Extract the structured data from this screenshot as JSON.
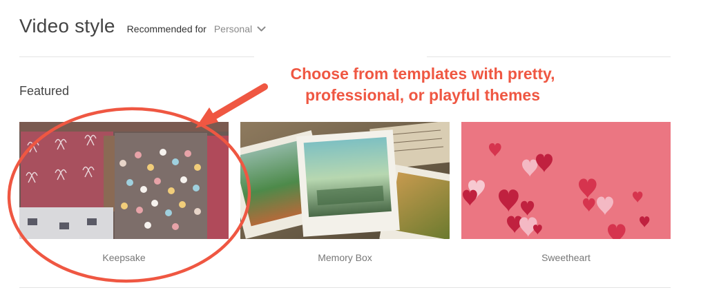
{
  "header": {
    "title": "Video style",
    "recommended_label": "Recommended for",
    "recommended_value": "Personal"
  },
  "section": {
    "title": "Featured"
  },
  "cards": [
    {
      "label": "Keepsake"
    },
    {
      "label": "Memory Box"
    },
    {
      "label": "Sweetheart"
    }
  ],
  "annotation": {
    "line1": "Choose from templates with pretty,",
    "line2": "professional, or playful themes",
    "color": "#ef5742"
  },
  "icons": {
    "dropdown": "chevron-down-icon"
  }
}
